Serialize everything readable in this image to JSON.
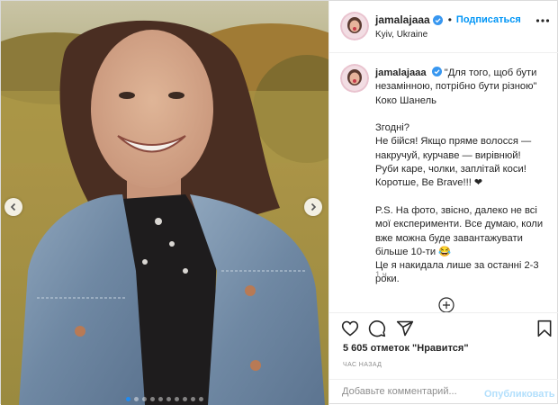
{
  "post": {
    "username": "jamalajaaa",
    "separator": "•",
    "follow_label": "Подписаться",
    "location": "Kyiv, Ukraine",
    "caption": {
      "author": "jamalajaaa",
      "line1": "\"Для того, щоб бути незамінною, потрібно бути різною\" Коко Шанель",
      "line2": "Згодні?",
      "line3": "Не бійся! Якщо пряме волосся — накручуй, курчаве — вирівнюй!",
      "line4": "Руби каре, чолки, заплітай коси!",
      "line5": "Коротше, Be Brave!!! ❤",
      "line6": "P.S. На фото, звісно, далеко не всі мої експерименти. Все думаю, коли вже можна буде завантажувати більше 10-ти 😂",
      "line7": "Це я накидала лише за останні 2-3 роки."
    },
    "caption_time": "1 ч.",
    "likes": "5 605 отметок \"Нравится\"",
    "time_ago": "ЧАС НАЗАД",
    "comment_placeholder": "Добавьте комментарий...",
    "publish_label": "Опубликовать",
    "carousel": {
      "slides": 10,
      "active_index": 0
    }
  },
  "colors": {
    "accent": "#0095f6",
    "publish_disabled": "#b2dffc",
    "secondary_text": "#8e8e8e",
    "active_dot": "#1f8bf2"
  },
  "icons": [
    "chevron-left-icon",
    "chevron-right-icon",
    "verified-badge-icon",
    "more-options-icon",
    "add-comment-plus-icon",
    "heart-icon",
    "comment-icon",
    "share-icon",
    "bookmark-icon"
  ]
}
